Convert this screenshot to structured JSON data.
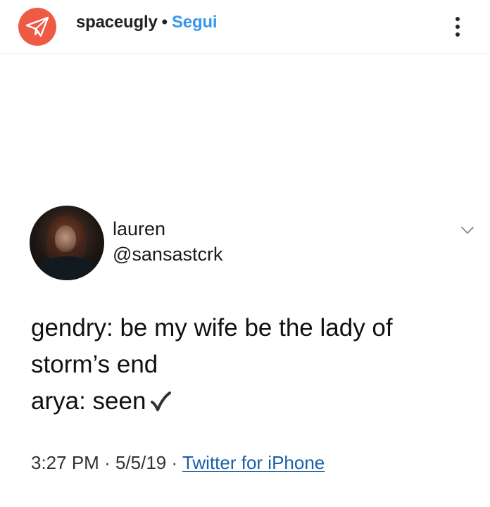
{
  "post_header": {
    "avatar_icon": "paper-plane-icon",
    "avatar_color": "#ef5a45",
    "username": "spaceugly",
    "separator": "•",
    "follow_label": "Segui",
    "follow_color": "#3897f0",
    "more_icon": "vertical-ellipsis-icon"
  },
  "tweet": {
    "display_name": "lauren",
    "handle": "@sansastcrk",
    "menu_icon": "chevron-down-icon",
    "lines": [
      "gendry: be my wife be the lady of",
      "storm’s end",
      "arya: seen"
    ],
    "checkmark_icon": "checkmark-icon",
    "time": "3:27 PM",
    "date": "5/5/19",
    "meta_separator": "·",
    "source": "Twitter for iPhone",
    "source_color": "#1b5faa"
  }
}
